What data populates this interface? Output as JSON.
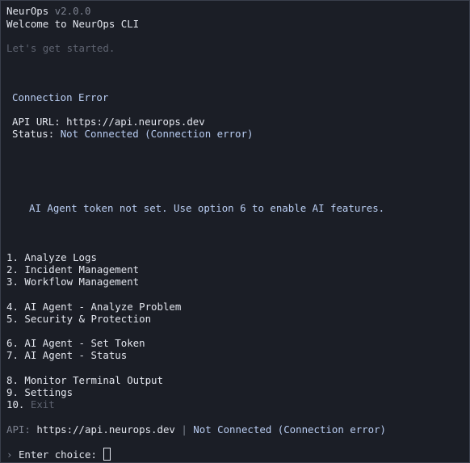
{
  "header": {
    "app_name": "NeurOps",
    "version": "v2.0.0",
    "welcome": "Welcome to NeurOps CLI",
    "tagline": "Let's get started."
  },
  "connection": {
    "title": "Connection Error",
    "api_label": "API URL:",
    "api_url": "https://api.neurops.dev",
    "status_label": "Status:",
    "status_value": "Not Connected (Connection error)"
  },
  "notice": "AI Agent token not set. Use option 6 to enable AI features.",
  "menu": [
    {
      "num": "1.",
      "label": "Analyze Logs"
    },
    {
      "num": "2.",
      "label": "Incident Management"
    },
    {
      "num": "3.",
      "label": "Workflow Management"
    },
    {
      "num": "4.",
      "label": "AI Agent - Analyze Problem"
    },
    {
      "num": "5.",
      "label": "Security & Protection"
    },
    {
      "num": "6.",
      "label": "AI Agent - Set Token"
    },
    {
      "num": "7.",
      "label": "AI Agent - Status"
    },
    {
      "num": "8.",
      "label": "Monitor Terminal Output"
    },
    {
      "num": "9.",
      "label": "Settings"
    },
    {
      "num": "10.",
      "label": "Exit"
    }
  ],
  "status_bar": {
    "api_label": "API:",
    "api_url": "https://api.neurops.dev",
    "separator": "|",
    "status": "Not Connected (Connection error)"
  },
  "prompt": {
    "icon": "›",
    "label": "Enter choice:",
    "value": ""
  },
  "colors": {
    "background": "#1b1e26",
    "text": "#e3e6ee",
    "muted": "#7d8290",
    "accent": "#b9cdf2"
  }
}
